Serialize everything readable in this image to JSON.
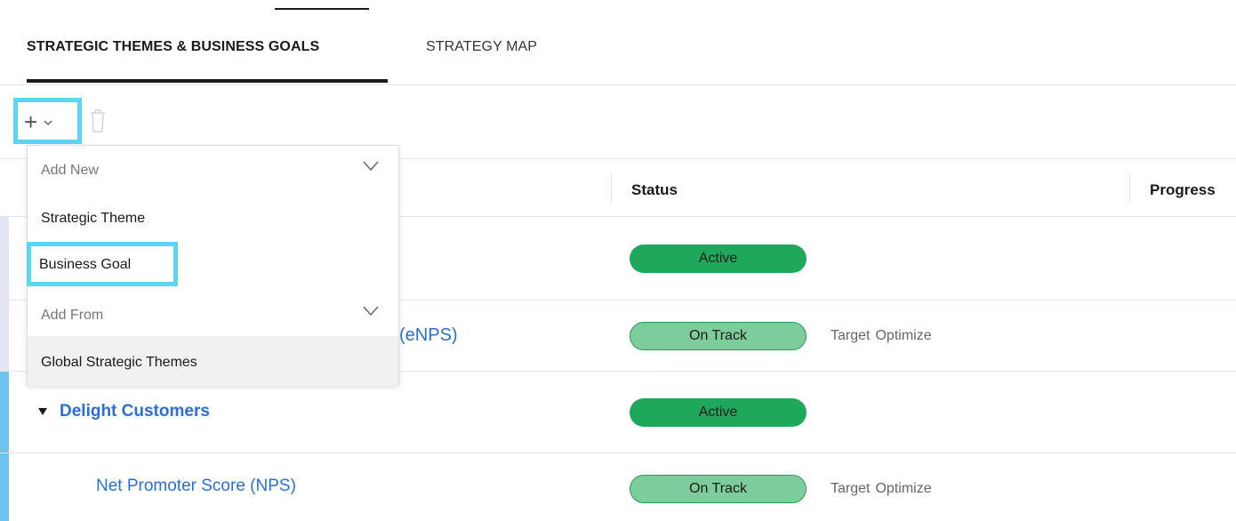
{
  "tabs": [
    {
      "label": "STRATEGIC THEMES & BUSINESS GOALS",
      "active": true
    },
    {
      "label": "STRATEGY MAP",
      "active": false
    }
  ],
  "toolbar": {
    "add_symbol": "+",
    "add_icon": "plus-icon",
    "dropdown_icon": "chevron-down-icon",
    "delete_icon": "trash-icon"
  },
  "dropdown": {
    "section_new": "Add New",
    "item_theme": "Strategic Theme",
    "item_goal": "Business Goal",
    "section_from": "Add From",
    "item_global": "Global Strategic Themes"
  },
  "table": {
    "headers": [
      "Status",
      "Progress"
    ],
    "rows": [
      {
        "name": "",
        "status": "Active",
        "meta_1": "",
        "meta_2": ""
      },
      {
        "name": "(eNPS)",
        "status": "On Track",
        "meta_1": "Target",
        "meta_2": "Optimize"
      },
      {
        "name": "Delight Customers",
        "status": "Active",
        "meta_1": "",
        "meta_2": ""
      },
      {
        "name": "Net Promoter Score  (NPS)",
        "status": "On Track",
        "meta_1": "Target",
        "meta_2": "Optimize"
      }
    ]
  },
  "colors": {
    "highlight": "#5ad6f2",
    "active_pill": "#1fa85c",
    "on_track_pill": "#7ccd9b",
    "link_blue": "#2a6fd6"
  }
}
